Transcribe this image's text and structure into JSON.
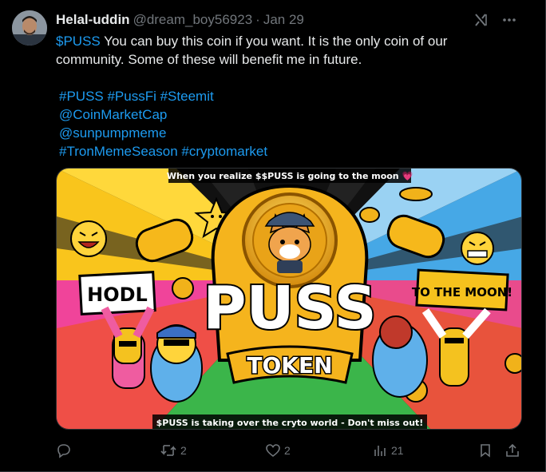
{
  "author": {
    "name": "Helal-uddin",
    "handle": "@dream_boy56923",
    "date": "Jan 29"
  },
  "tweet": {
    "cashtag": "$PUSS",
    "line1_rest": " You can buy this coin if you want.  It is the only coin of our community.  Some of these will benefit me in future.",
    "hashtags_line": "#PUSS #PussFi #Steemit",
    "mention1": "@CoinMarketCap",
    "mention2": "@sunpumpmeme",
    "hashtags_line2": "#TronMemeSeason #cryptomarket"
  },
  "media": {
    "caption_top": "When you realize $$PUSS is going to the moon 💗",
    "caption_bottom": "$PUSS is taking over the cryto world - Don't miss out!",
    "title_main": "PUSS",
    "title_sub": "TOKEN",
    "sign_left": "HODL",
    "sign_right": "TO THE MOON!"
  },
  "actions": {
    "reply_count": "",
    "retweet_count": "2",
    "like_count": "2",
    "views_count": "21"
  },
  "colors": {
    "link": "#1d9bf0",
    "muted": "#71767b",
    "text": "#e7e9ea",
    "background": "#000000"
  }
}
